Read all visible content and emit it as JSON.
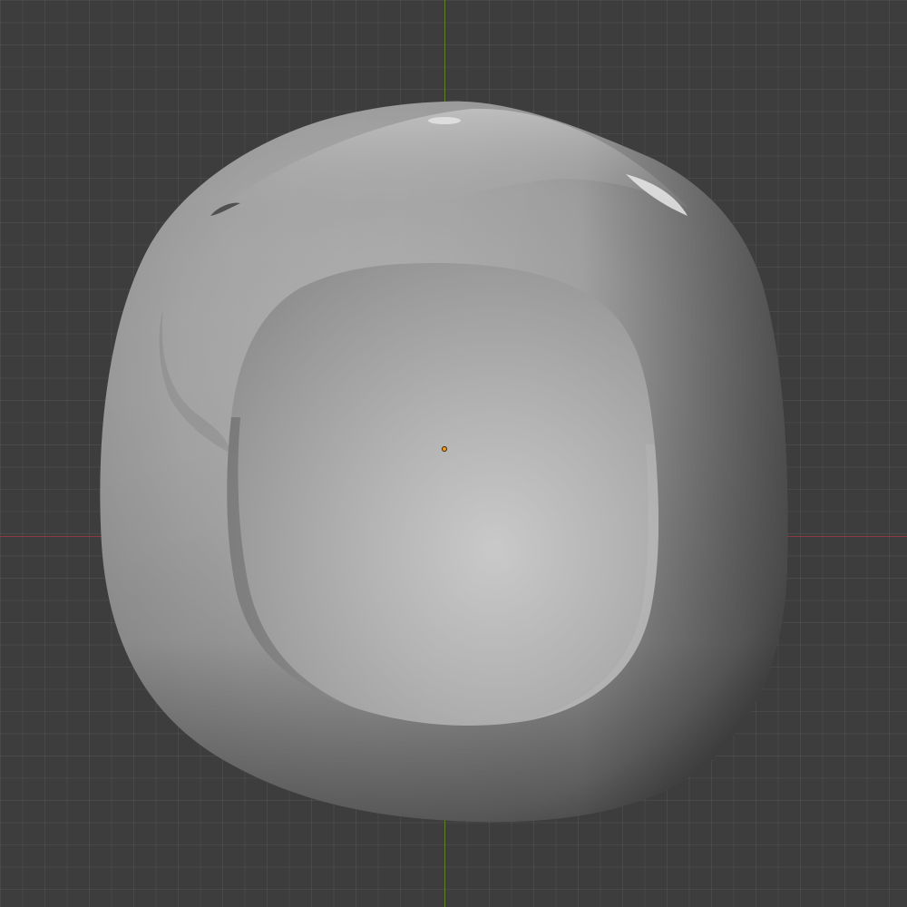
{
  "viewport": {
    "background_color": "#3d3d3d",
    "grid_color": "#4a4a4a",
    "x_axis_color": "#8a3a44",
    "y_axis_color": "#5f7f28",
    "origin_color": "#f29b1e"
  },
  "mesh": {
    "shade_light": "#c9c9c9",
    "shade_mid": "#9e9e9e",
    "shade_dark": "#5c5c5c"
  }
}
